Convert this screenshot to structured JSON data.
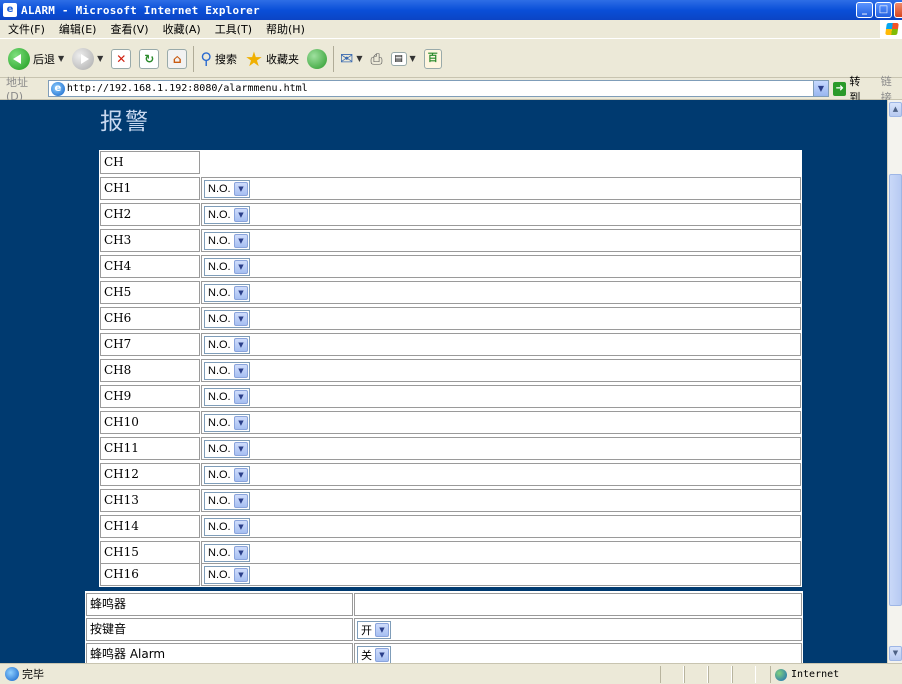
{
  "window": {
    "title": "ALARM - Microsoft Internet Explorer"
  },
  "menu": [
    "文件(F)",
    "编辑(E)",
    "查看(V)",
    "收藏(A)",
    "工具(T)",
    "帮助(H)"
  ],
  "toolbar": {
    "back_label": "后退",
    "search_label": "搜索",
    "favorites_label": "收藏夹"
  },
  "address": {
    "label": "地址(D)",
    "url": "http://192.168.1.192:8080/alarmmenu.html",
    "go_label": "转到",
    "links_label": "链接"
  },
  "page": {
    "heading": "报警",
    "channel_header": "CH",
    "channels": [
      {
        "name": "CH1",
        "mode": "N.O."
      },
      {
        "name": "CH2",
        "mode": "N.O."
      },
      {
        "name": "CH3",
        "mode": "N.O."
      },
      {
        "name": "CH4",
        "mode": "N.O."
      },
      {
        "name": "CH5",
        "mode": "N.O."
      },
      {
        "name": "CH6",
        "mode": "N.O."
      },
      {
        "name": "CH7",
        "mode": "N.O."
      },
      {
        "name": "CH8",
        "mode": "N.O."
      },
      {
        "name": "CH9",
        "mode": "N.O."
      },
      {
        "name": "CH10",
        "mode": "N.O."
      },
      {
        "name": "CH11",
        "mode": "N.O."
      },
      {
        "name": "CH12",
        "mode": "N.O."
      },
      {
        "name": "CH13",
        "mode": "N.O."
      },
      {
        "name": "CH14",
        "mode": "N.O."
      },
      {
        "name": "CH15",
        "mode": "N.O."
      },
      {
        "name": "CH16",
        "mode": "N.O."
      }
    ],
    "buzzer": {
      "header": "蜂鸣器",
      "rows": [
        {
          "label": "按键音",
          "value": "开"
        },
        {
          "label": "蜂鸣器 Alarm",
          "value": "关"
        }
      ]
    }
  },
  "status": {
    "text": "完毕",
    "zone": "Internet"
  },
  "colors": {
    "content_background": "#003a70",
    "title_bar": "#0a4fd8"
  }
}
